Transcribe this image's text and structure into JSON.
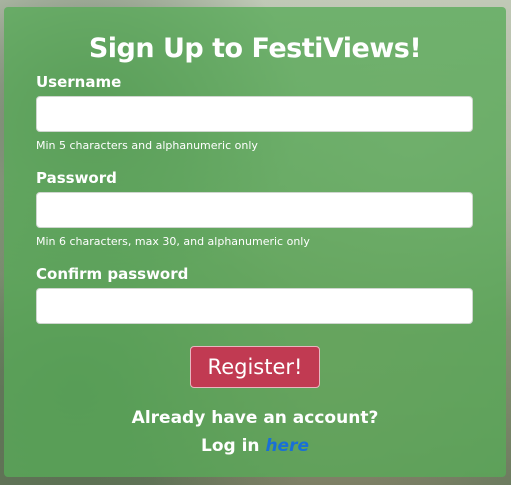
{
  "form": {
    "title": "Sign Up to FestiViews!",
    "username": {
      "label": "Username",
      "value": "",
      "hint": "Min 5 characters and alphanumeric only"
    },
    "password": {
      "label": "Password",
      "value": "",
      "hint": "Min 6 characters, max 30, and alphanumeric only"
    },
    "confirm_password": {
      "label": "Confirm password",
      "value": ""
    },
    "register_label": "Register!",
    "login_prompt": "Already have an account?",
    "login_prefix": "Log in ",
    "login_link": "here"
  },
  "colors": {
    "card_background": "#58aa58",
    "register_button": "#c13a52",
    "link": "#1a6fd6",
    "text": "#ffffff"
  }
}
